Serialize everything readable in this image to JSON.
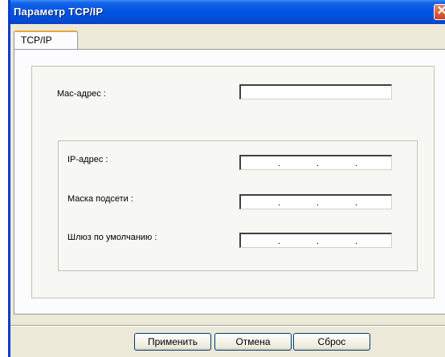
{
  "window": {
    "title": "Параметр TCP/IP"
  },
  "tabs": [
    {
      "label": "TCP/IP"
    }
  ],
  "fields": {
    "mac": {
      "label": "Mac-адрес :",
      "value": ""
    },
    "ip": {
      "label": "IP-адрес :",
      "value": ". . ."
    },
    "subnet": {
      "label": "Маска подсети :",
      "value": ". . ."
    },
    "gateway": {
      "label": "Шлюз по умолчанию :",
      "value": ". . ."
    }
  },
  "buttons": {
    "apply": "Применить",
    "cancel": "Отмена",
    "reset": "Сброс"
  },
  "icons": {
    "close": "close-icon"
  },
  "colors": {
    "titlebar": "#0054e3",
    "window_bg": "#ece9d8",
    "close_button": "#c9421c",
    "tab_highlight": "#e8a53a"
  }
}
